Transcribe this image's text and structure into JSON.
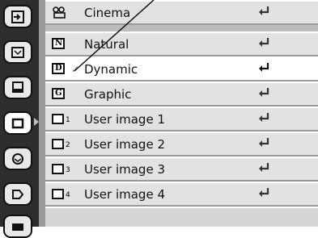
{
  "sidebar": {
    "tabs": [
      {
        "icon": "input-icon"
      },
      {
        "icon": "screen-icon"
      },
      {
        "icon": "computer-icon"
      },
      {
        "icon": "image-adjust-icon",
        "active": true
      },
      {
        "icon": "setting-icon"
      },
      {
        "icon": "sound-icon"
      },
      {
        "icon": "projector-icon"
      }
    ]
  },
  "menu": {
    "items": [
      {
        "label": "Cinema",
        "icon": "cinema-icon"
      },
      {
        "label": "Natural",
        "icon": "n-icon",
        "icon_text": "N"
      },
      {
        "label": "Dynamic",
        "icon": "d-icon",
        "icon_text": "D",
        "selected": true,
        "checked": true
      },
      {
        "label": "Graphic",
        "icon": "g-icon",
        "icon_text": "G"
      },
      {
        "label": "User image 1",
        "icon": "user-image-icon",
        "icon_sub": "1"
      },
      {
        "label": "User image 2",
        "icon": "user-image-icon",
        "icon_sub": "2"
      },
      {
        "label": "User image 3",
        "icon": "user-image-icon",
        "icon_sub": "3"
      },
      {
        "label": "User image 4",
        "icon": "user-image-icon",
        "icon_sub": "4"
      }
    ],
    "check_glyph": "✓"
  }
}
